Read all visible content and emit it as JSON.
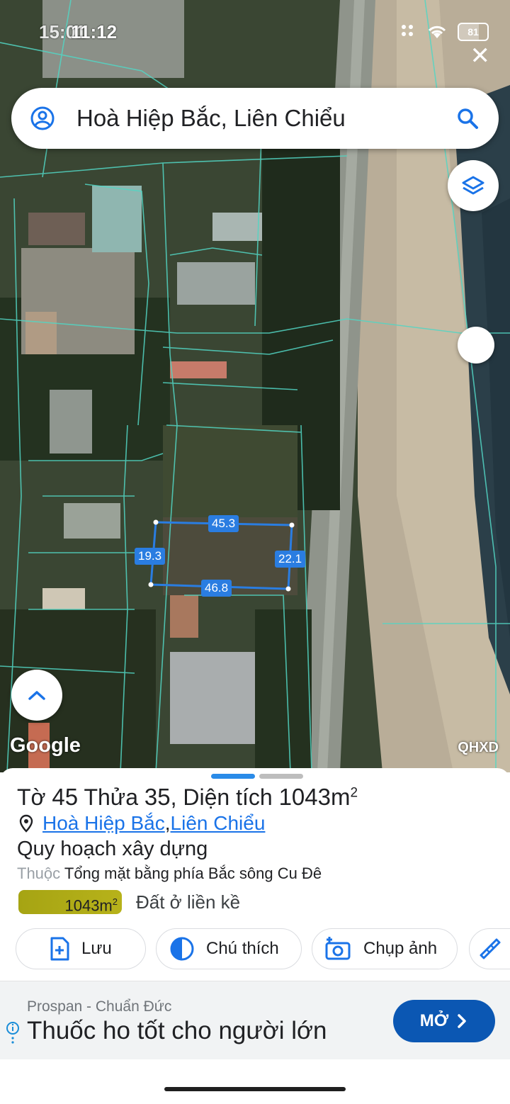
{
  "status": {
    "time_ghost": "15:01",
    "time": "11:12",
    "battery": "81"
  },
  "search": {
    "query": "Hoà Hiệp Bắc, Liên Chiểu"
  },
  "map": {
    "measurements": [
      "45.3",
      "19.3",
      "22.1",
      "46.8"
    ],
    "google_label": "Google",
    "overlay_label": "QHXD"
  },
  "parcel": {
    "title_prefix": "Tờ",
    "sheet_no": "45",
    "parcel_label": "Thửa",
    "parcel_no": "35",
    "area_label": ", Diện tích",
    "area_value": "1043m",
    "area_unit_sup": "2",
    "ward": "Hoà Hiệp Bắc",
    "separator": ", ",
    "district": "Liên Chiểu"
  },
  "plan": {
    "title": "Quy hoạch xây dựng",
    "belongs_label": "Thuộc",
    "belongs_value": "Tổng mặt bằng phía Bắc sông Cu Đê",
    "area_chip": "1043m",
    "area_chip_sup": "2",
    "land_use": "Đất ở liền kề",
    "land_use_color": "#b2ad14"
  },
  "actions": {
    "save": "Lưu",
    "legend": "Chú thích",
    "photo": "Chụp ảnh"
  },
  "ad": {
    "brand": "Prospan - Chuẩn Đức",
    "headline": "Thuốc ho tốt cho người lớn",
    "open": "MỞ"
  },
  "colors": {
    "accent": "#1a73e8",
    "open_button": "#0b57b3",
    "parcel_outline": "#2a7de1"
  }
}
